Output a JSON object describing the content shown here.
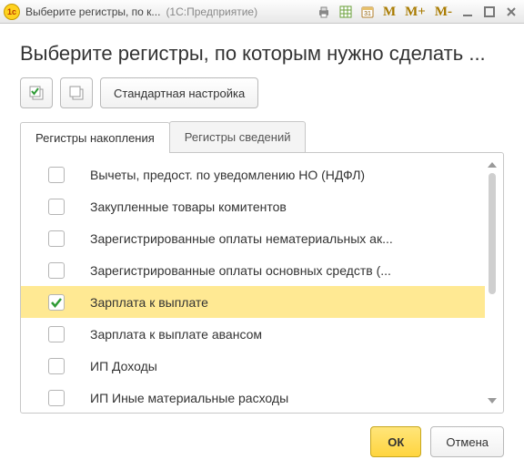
{
  "titlebar": {
    "title": "Выберите регистры, по к...",
    "app": "(1С:Предприятие)",
    "mem1": "M",
    "mem2": "M+",
    "mem3": "M-"
  },
  "heading": "Выберите регистры, по которым нужно сделать ...",
  "toolbar": {
    "default_settings": "Стандартная настройка"
  },
  "tabs": {
    "accum": "Регистры накопления",
    "info": "Регистры сведений"
  },
  "rows": [
    {
      "label": "Вычеты, предост. по уведомлению НО (НДФЛ)",
      "checked": false,
      "selected": false
    },
    {
      "label": "Закупленные товары комитентов",
      "checked": false,
      "selected": false
    },
    {
      "label": "Зарегистрированные оплаты нематериальных ак...",
      "checked": false,
      "selected": false
    },
    {
      "label": "Зарегистрированные оплаты основных средств (...",
      "checked": false,
      "selected": false
    },
    {
      "label": "Зарплата к выплате",
      "checked": true,
      "selected": true
    },
    {
      "label": "Зарплата к выплате авансом",
      "checked": false,
      "selected": false
    },
    {
      "label": "ИП Доходы",
      "checked": false,
      "selected": false
    },
    {
      "label": "ИП Иные материальные расходы",
      "checked": false,
      "selected": false
    }
  ],
  "footer": {
    "ok": "ОК",
    "cancel": "Отмена"
  }
}
